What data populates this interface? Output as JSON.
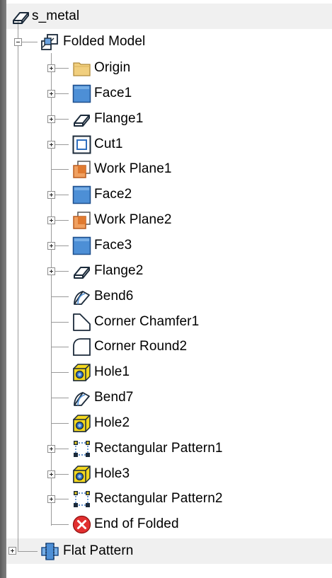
{
  "root": {
    "label": "s_metal",
    "icon": "sheet-metal-part-icon"
  },
  "folded": {
    "label": "Folded Model",
    "icon": "folded-model-icon",
    "expanded": true
  },
  "items": [
    {
      "label": "Origin",
      "icon": "folder-icon",
      "expander": true
    },
    {
      "label": "Face1",
      "icon": "face-icon",
      "expander": true
    },
    {
      "label": "Flange1",
      "icon": "flange-icon",
      "expander": true
    },
    {
      "label": "Cut1",
      "icon": "cut-icon",
      "expander": true
    },
    {
      "label": "Work Plane1",
      "icon": "work-plane-icon",
      "expander": false
    },
    {
      "label": "Face2",
      "icon": "face-icon",
      "expander": true
    },
    {
      "label": "Work Plane2",
      "icon": "work-plane-icon",
      "expander": true
    },
    {
      "label": "Face3",
      "icon": "face-icon",
      "expander": true
    },
    {
      "label": "Flange2",
      "icon": "flange-icon",
      "expander": true
    },
    {
      "label": "Bend6",
      "icon": "bend-icon",
      "expander": false
    },
    {
      "label": "Corner Chamfer1",
      "icon": "corner-chamfer-icon",
      "expander": false
    },
    {
      "label": "Corner Round2",
      "icon": "corner-round-icon",
      "expander": false
    },
    {
      "label": "Hole1",
      "icon": "hole-icon",
      "expander": false
    },
    {
      "label": "Bend7",
      "icon": "bend-icon",
      "expander": false
    },
    {
      "label": "Hole2",
      "icon": "hole-icon",
      "expander": false
    },
    {
      "label": "Rectangular Pattern1",
      "icon": "rectangular-pattern-icon",
      "expander": true
    },
    {
      "label": "Hole3",
      "icon": "hole-icon",
      "expander": true
    },
    {
      "label": "Rectangular Pattern2",
      "icon": "rectangular-pattern-icon",
      "expander": true
    },
    {
      "label": "End of Folded",
      "icon": "end-of-part-icon",
      "expander": false
    }
  ],
  "flat": {
    "label": "Flat Pattern",
    "icon": "flat-pattern-icon",
    "expander": true
  },
  "colors": {
    "face_blue": "#4d8fd6",
    "folder_tan": "#f1cf7e",
    "hole_yellow": "#f4d81e",
    "end_red": "#e23030",
    "tree_line": "#9a9a9a"
  }
}
